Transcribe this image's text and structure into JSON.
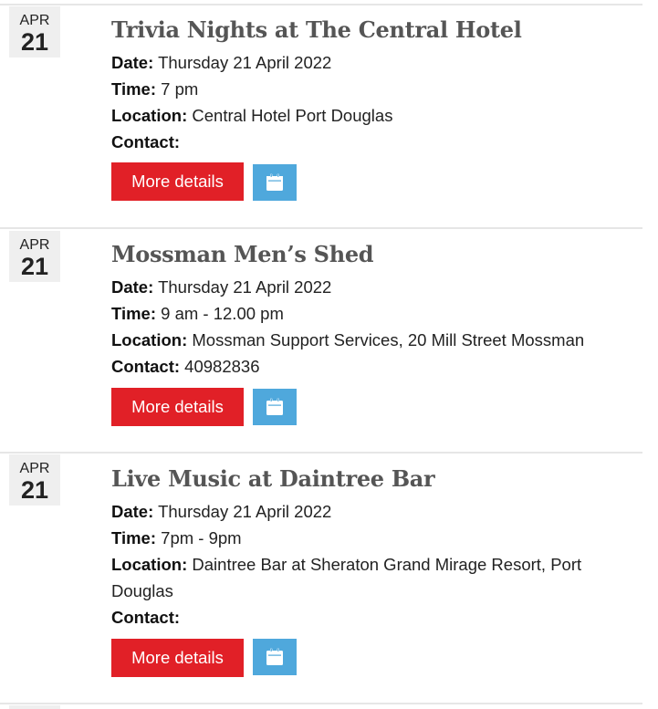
{
  "events": [
    {
      "month": "APR",
      "day": "21",
      "title": "Trivia Nights at The Central Hotel",
      "date_label": "Date:",
      "date_value": "Thursday 21 April 2022",
      "time_label": "Time:",
      "time_value": "7 pm",
      "location_label": "Location:",
      "location_value": "Central Hotel Port Douglas",
      "location_value_2": "",
      "contact_label": "Contact:",
      "contact_value": "",
      "button_label": "More details",
      "calendar_icon": "calendar-icon"
    },
    {
      "month": "APR",
      "day": "21",
      "title": "Mossman Men’s Shed",
      "date_label": "Date:",
      "date_value": "Thursday 21 April 2022",
      "time_label": "Time:",
      "time_value": "9 am - 12.00 pm",
      "location_label": "Location:",
      "location_value": "Mossman Support Services, 20 Mill Street Mossman",
      "location_value_2": "",
      "contact_label": "Contact:",
      "contact_value": "40982836",
      "button_label": "More details",
      "calendar_icon": "calendar-icon"
    },
    {
      "month": "APR",
      "day": "21",
      "title": "Live Music at Daintree Bar",
      "date_label": "Date:",
      "date_value": "Thursday 21 April 2022",
      "time_label": "Time:",
      "time_value": "7pm - 9pm",
      "location_label": "Location:",
      "location_value": "Daintree Bar at Sheraton Grand Mirage Resort, Port",
      "location_value_2": "Douglas",
      "contact_label": "Contact:",
      "contact_value": "",
      "button_label": "More details",
      "calendar_icon": "calendar-icon"
    }
  ],
  "colors": {
    "button_red": "#e12027",
    "calendar_blue": "#4fa8dc",
    "title_grey": "#555555",
    "datebox_bg": "#efefef"
  }
}
